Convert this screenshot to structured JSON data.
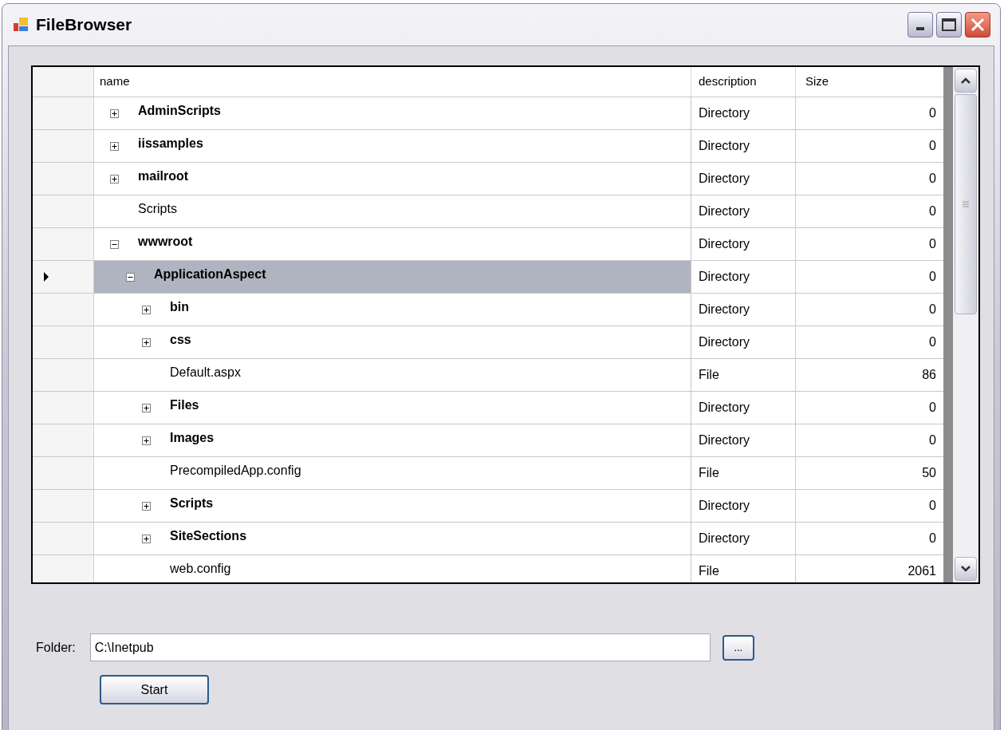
{
  "window": {
    "title": "FileBrowser"
  },
  "grid": {
    "columns": [
      "name",
      "description",
      "Size"
    ],
    "tree": [
      {
        "name": "AdminScripts",
        "kind": "branch",
        "expanded": false,
        "selected": false,
        "description": "Directory",
        "size": "0"
      },
      {
        "name": "iissamples",
        "kind": "branch",
        "expanded": false,
        "selected": false,
        "description": "Directory",
        "size": "0"
      },
      {
        "name": "mailroot",
        "kind": "branch",
        "expanded": false,
        "selected": false,
        "description": "Directory",
        "size": "0"
      },
      {
        "name": "Scripts",
        "kind": "leaf",
        "selected": false,
        "description": "Directory",
        "size": "0"
      },
      {
        "name": "wwwroot",
        "kind": "branch",
        "expanded": true,
        "selected": false,
        "description": "Directory",
        "size": "0",
        "children": [
          {
            "name": "ApplicationAspect",
            "kind": "branch",
            "expanded": true,
            "selected": true,
            "description": "Directory",
            "size": "0",
            "children": [
              {
                "name": "bin",
                "kind": "branch",
                "expanded": false,
                "selected": false,
                "description": "Directory",
                "size": "0"
              },
              {
                "name": "css",
                "kind": "branch",
                "expanded": false,
                "selected": false,
                "description": "Directory",
                "size": "0"
              },
              {
                "name": "Default.aspx",
                "kind": "leaf",
                "selected": false,
                "description": "File",
                "size": "86"
              },
              {
                "name": "Files",
                "kind": "branch",
                "expanded": false,
                "selected": false,
                "description": "Directory",
                "size": "0"
              },
              {
                "name": "Images",
                "kind": "branch",
                "expanded": false,
                "selected": false,
                "description": "Directory",
                "size": "0"
              },
              {
                "name": "PrecompiledApp.config",
                "kind": "leaf",
                "selected": false,
                "description": "File",
                "size": "50"
              },
              {
                "name": "Scripts",
                "kind": "branch",
                "expanded": false,
                "selected": false,
                "description": "Directory",
                "size": "0"
              },
              {
                "name": "SiteSections",
                "kind": "branch",
                "expanded": false,
                "selected": false,
                "description": "Directory",
                "size": "0"
              },
              {
                "name": "web.config",
                "kind": "leaf",
                "selected": false,
                "description": "File",
                "size": "2061"
              }
            ]
          }
        ]
      }
    ]
  },
  "folder": {
    "label": "Folder:",
    "value": "C:\\Inetpub",
    "browse_button": "...",
    "start_button": "Start"
  }
}
